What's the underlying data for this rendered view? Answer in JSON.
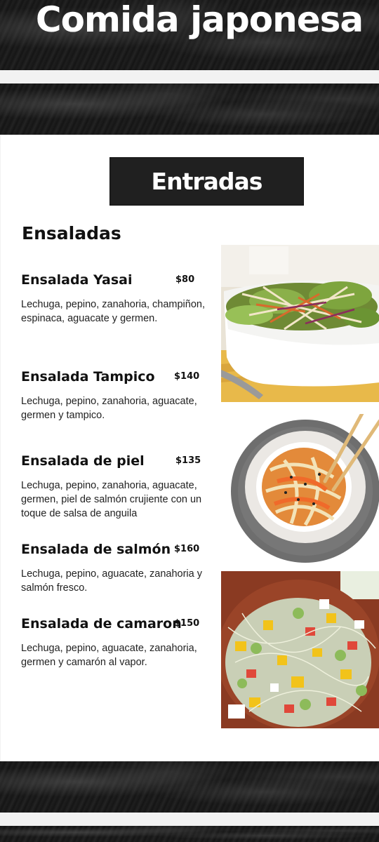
{
  "header": {
    "title": "Comida japonesa"
  },
  "section": {
    "title": "Entradas"
  },
  "category": {
    "title": "Ensaladas"
  },
  "items": [
    {
      "name": "Ensalada Yasai",
      "price": "$80",
      "description": "Lechuga, pepino, zanahoria, champiñon, espinaca, aguacate y germen."
    },
    {
      "name": "Ensalada Tampico",
      "price": "$140",
      "description": "Lechuga, pepino, zanahoria, aguacate, germen y tampico."
    },
    {
      "name": "Ensalada de piel",
      "price": "$135",
      "description": "Lechuga, pepino, zanahoria, aguacate, germen, piel de salmón crujiente con un toque de salsa de anguila"
    },
    {
      "name": "Ensalada de salmón",
      "price": "$160",
      "description": "Lechuga, pepino, aguacate, zanahoria y salmón fresco."
    },
    {
      "name": "Ensalada de camaron",
      "price": "$150",
      "description": "Lechuga, pepino, aguacate, zanahoria, germen y camarón al vapor."
    }
  ],
  "photos": [
    {
      "icon": "salad-bowl-photo"
    },
    {
      "icon": "noodle-bowl-photo"
    },
    {
      "icon": "sprout-salad-photo"
    }
  ],
  "colors": {
    "dark": "#1a1a1a",
    "panel": "#ffffff",
    "text": "#111111"
  }
}
